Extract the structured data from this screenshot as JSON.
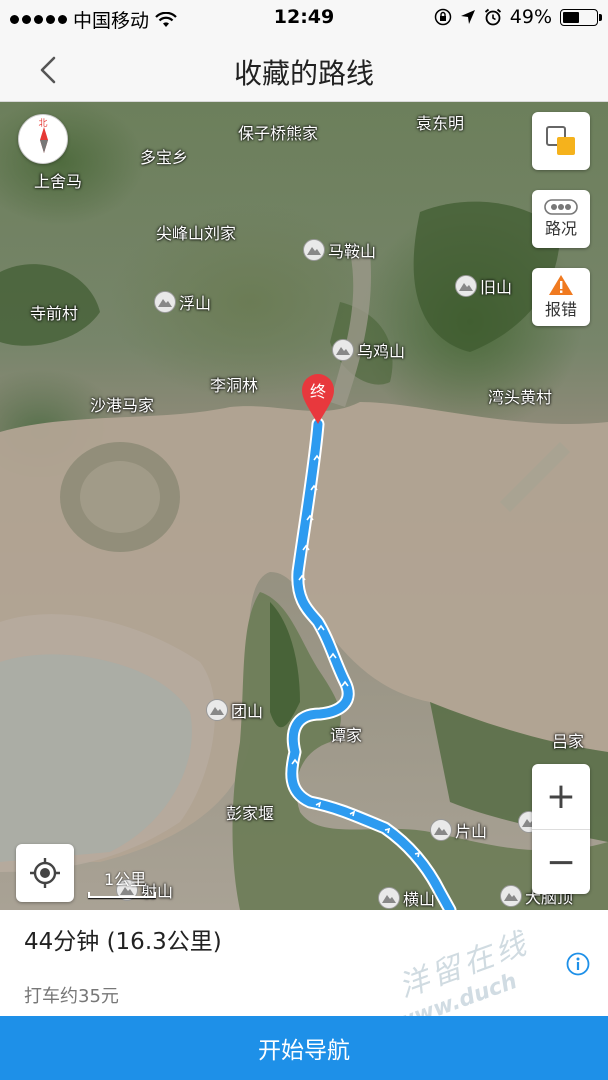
{
  "status_bar": {
    "carrier": "中国移动",
    "time": "12:49",
    "battery": "49%",
    "battery_level": 0.49
  },
  "nav": {
    "title": "收藏的路线",
    "back_icon": "chevron-left-icon"
  },
  "map": {
    "compass_label": "北",
    "places": [
      "保子桥熊家",
      "袁东明",
      "多宝乡",
      "上舍马",
      "尖峰山刘家",
      "寺前村",
      "李洞林",
      "沙港马家",
      "湾头黄村",
      "谭家",
      "吕家",
      "彭家堰"
    ],
    "peaks": [
      "马鞍山",
      "旧山",
      "浮山",
      "乌鸡山",
      "团山",
      "片山",
      "团山",
      "射山",
      "横山",
      "大脑顶"
    ],
    "end_marker": "终",
    "controls": {
      "traffic_label": "路况",
      "report_label": "报错",
      "zoom_in": "+",
      "zoom_out": "−"
    },
    "scale_label": "1公里"
  },
  "route": {
    "duration": "44分钟 (16.3公里)",
    "taxi": "打车约35元",
    "route_color": "#2d9bf0"
  },
  "watermark": {
    "text": "洋留在线",
    "url": "www.duch"
  },
  "action": {
    "start_nav": "开始导航",
    "color": "#1e90e8"
  }
}
